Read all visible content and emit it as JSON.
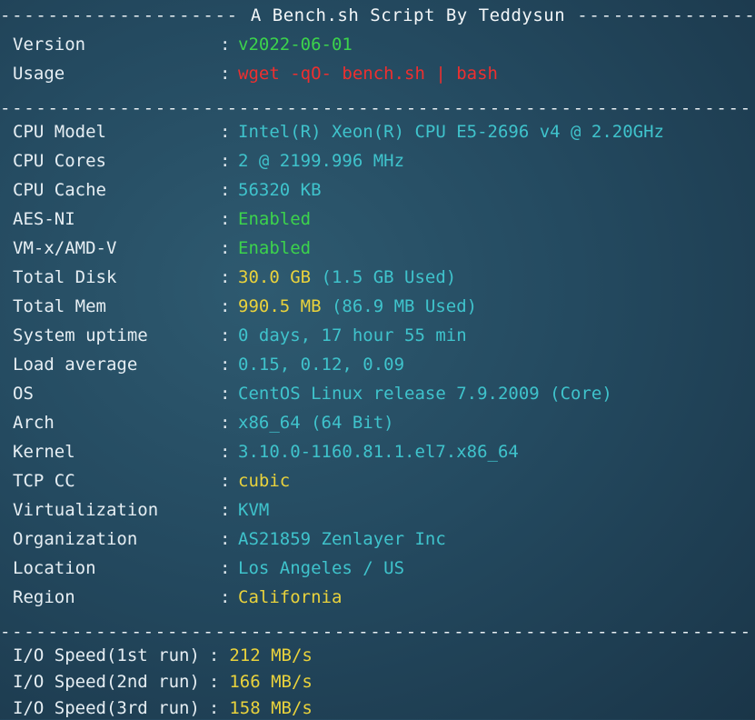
{
  "header": {
    "dashes_left": "--------------------",
    "title": "A Bench.sh Script By Teddysun",
    "dashes_right": "--------------------"
  },
  "separator": "------------------------------------------------------------------------------",
  "colon": ":",
  "meta": [
    {
      "label": "Version",
      "value": "v2022-06-01",
      "color": "#3cd34c"
    },
    {
      "label": "Usage",
      "value": "wget -qO- bench.sh | bash",
      "color": "#ee2f2f"
    }
  ],
  "system": [
    {
      "label": "CPU Model",
      "parts": [
        {
          "text": "Intel(R) Xeon(R) CPU E5-2696 v4 @ 2.20GHz",
          "c": "cyan"
        }
      ]
    },
    {
      "label": "CPU Cores",
      "parts": [
        {
          "text": "2 @ 2199.996 MHz",
          "c": "cyan"
        }
      ]
    },
    {
      "label": "CPU Cache",
      "parts": [
        {
          "text": "56320 KB",
          "c": "cyan"
        }
      ]
    },
    {
      "label": "AES-NI",
      "parts": [
        {
          "text": "Enabled",
          "c": "green"
        }
      ]
    },
    {
      "label": "VM-x/AMD-V",
      "parts": [
        {
          "text": "Enabled",
          "c": "green"
        }
      ]
    },
    {
      "label": "Total Disk",
      "parts": [
        {
          "text": "30.0 GB",
          "c": "yellow"
        },
        {
          "text": " (1.5 GB Used)",
          "c": "cyan"
        }
      ]
    },
    {
      "label": "Total Mem",
      "parts": [
        {
          "text": "990.5 MB",
          "c": "yellow"
        },
        {
          "text": " (86.9 MB Used)",
          "c": "cyan"
        }
      ]
    },
    {
      "label": "System uptime",
      "parts": [
        {
          "text": "0 days, 17 hour 55 min",
          "c": "cyan"
        }
      ]
    },
    {
      "label": "Load average",
      "parts": [
        {
          "text": "0.15, 0.12, 0.09",
          "c": "cyan"
        }
      ]
    },
    {
      "label": "OS",
      "parts": [
        {
          "text": "CentOS Linux release 7.9.2009 (Core)",
          "c": "cyan"
        }
      ]
    },
    {
      "label": "Arch",
      "parts": [
        {
          "text": "x86_64 (64 Bit)",
          "c": "cyan"
        }
      ]
    },
    {
      "label": "Kernel",
      "parts": [
        {
          "text": "3.10.0-1160.81.1.el7.x86_64",
          "c": "cyan"
        }
      ]
    },
    {
      "label": "TCP CC",
      "parts": [
        {
          "text": "cubic",
          "c": "yellow"
        }
      ]
    },
    {
      "label": "Virtualization",
      "parts": [
        {
          "text": "KVM",
          "c": "cyan"
        }
      ]
    },
    {
      "label": "Organization",
      "parts": [
        {
          "text": "AS21859 Zenlayer Inc",
          "c": "cyan"
        }
      ]
    },
    {
      "label": "Location",
      "parts": [
        {
          "text": "Los Angeles / US",
          "c": "cyan"
        }
      ]
    },
    {
      "label": "Region",
      "parts": [
        {
          "text": "California",
          "c": "yellow"
        }
      ]
    }
  ],
  "io": [
    {
      "label": "I/O Speed(1st run)",
      "value": "212 MB/s"
    },
    {
      "label": "I/O Speed(2nd run)",
      "value": "166 MB/s"
    },
    {
      "label": "I/O Speed(3rd run)",
      "value": "158 MB/s"
    }
  ],
  "colors": {
    "background": "#244a60",
    "green": "#3cd34c",
    "red": "#ee2f2f",
    "cyan": "#3fc3cc",
    "yellow": "#e9d23c"
  }
}
